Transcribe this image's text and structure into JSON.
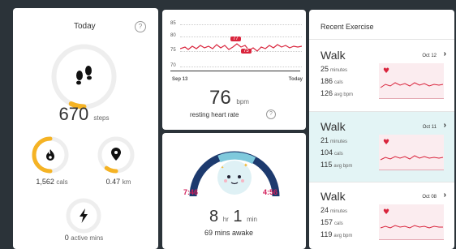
{
  "today": {
    "title": "Today",
    "help": "?",
    "steps": {
      "value": "670",
      "unit": "steps",
      "progress": 0.07
    },
    "calories": {
      "value": "1,562",
      "unit": "cals",
      "progress": 0.5
    },
    "distance": {
      "value": "0.47",
      "unit": "km",
      "progress": 0.1
    },
    "active": {
      "value": "0",
      "unit": "active mins",
      "progress": 0
    }
  },
  "heart_rate": {
    "y_ticks": [
      "85",
      "80",
      "75",
      "70"
    ],
    "x_start": "Sep 13",
    "x_end": "Today",
    "max_badge": "77",
    "min_badge": "75",
    "value": "76",
    "unit": "bpm",
    "label": "resting heart rate",
    "help": "?"
  },
  "sleep": {
    "start": "7:46",
    "end": "4:56",
    "hours": "8",
    "hours_unit": "hr",
    "minutes": "1",
    "minutes_unit": "min",
    "awake": "69 mins awake"
  },
  "recent_exercise": {
    "title": "Recent Exercise",
    "items": [
      {
        "name": "Walk",
        "date": "Oct 12",
        "minutes": "25",
        "minutes_unit": "minutes",
        "cals": "186",
        "cals_unit": "cals",
        "bpm": "126",
        "bpm_unit": "avg bpm"
      },
      {
        "name": "Walk",
        "date": "Oct 11",
        "minutes": "21",
        "minutes_unit": "minutes",
        "cals": "104",
        "cals_unit": "cals",
        "bpm": "115",
        "bpm_unit": "avg bpm"
      },
      {
        "name": "Walk",
        "date": "Oct 08",
        "minutes": "24",
        "minutes_unit": "minutes",
        "cals": "157",
        "cals_unit": "cals",
        "bpm": "119",
        "bpm_unit": "avg bpm"
      }
    ]
  },
  "colors": {
    "accent_yellow": "#f5b324",
    "heart_red": "#d9243c",
    "sleep_blue": "#1d3a6e",
    "sleep_pink": "#d21e5a",
    "teal_bg": "#e3f4f5",
    "bg": "#2b3339"
  }
}
